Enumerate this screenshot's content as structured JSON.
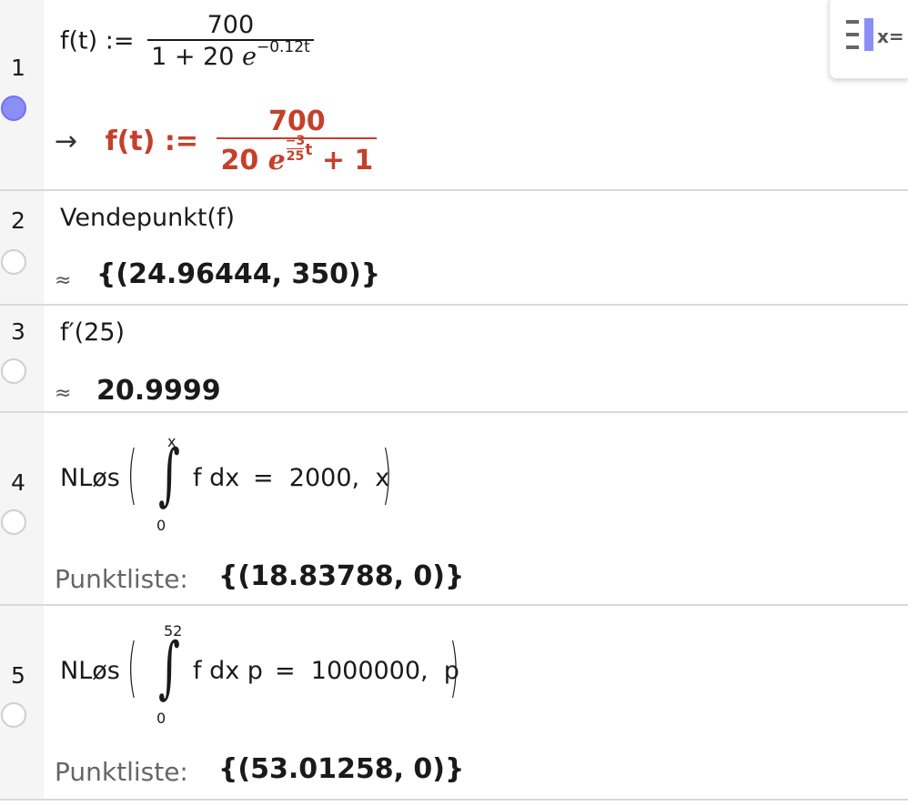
{
  "rows": [
    {
      "number": "1",
      "visible": true,
      "input": {
        "lhs": "f(t) :=",
        "numerator": "700",
        "den_prefix": "1 + 20",
        "exp_base": "e",
        "exponent": "−0.12t"
      },
      "output": {
        "arrow": "→",
        "lhs": "f(t) :=",
        "numerator": "700",
        "den_coef": "20",
        "exp_base": "e",
        "exp_frac_num": "−3",
        "exp_frac_den": "25",
        "exp_var": "t",
        "den_suffix": "+ 1"
      }
    },
    {
      "number": "2",
      "visible": false,
      "input": "Vendepunkt(f)",
      "approx": "≈",
      "output": "{(24.96444, 350)}"
    },
    {
      "number": "3",
      "visible": false,
      "input": "f′(25)",
      "approx": "≈",
      "output": "20.9999"
    },
    {
      "number": "4",
      "visible": false,
      "input": {
        "func": "NLøs",
        "upper": "x",
        "lower": "0",
        "integrand": "f dx",
        "rhs": "=  2000,  x"
      },
      "output_label": "Punktliste:",
      "output": "{(18.83788, 0)}"
    },
    {
      "number": "5",
      "visible": false,
      "input": {
        "func": "NLøs",
        "upper": "52",
        "lower": "0",
        "integrand": "f dx p",
        "rhs": "=  1000000,  p"
      },
      "output_label": "Punktliste:",
      "output": "{(53.01258, 0)}"
    }
  ],
  "toolbar": {
    "algebra_icon": "algebra-view-icon",
    "algebra_label": "x="
  },
  "colors": {
    "output_red": "#c5402b",
    "toggle_on": "#8a8ef5",
    "gutter": "#f5f5f5",
    "divider": "#d9d9d9"
  }
}
